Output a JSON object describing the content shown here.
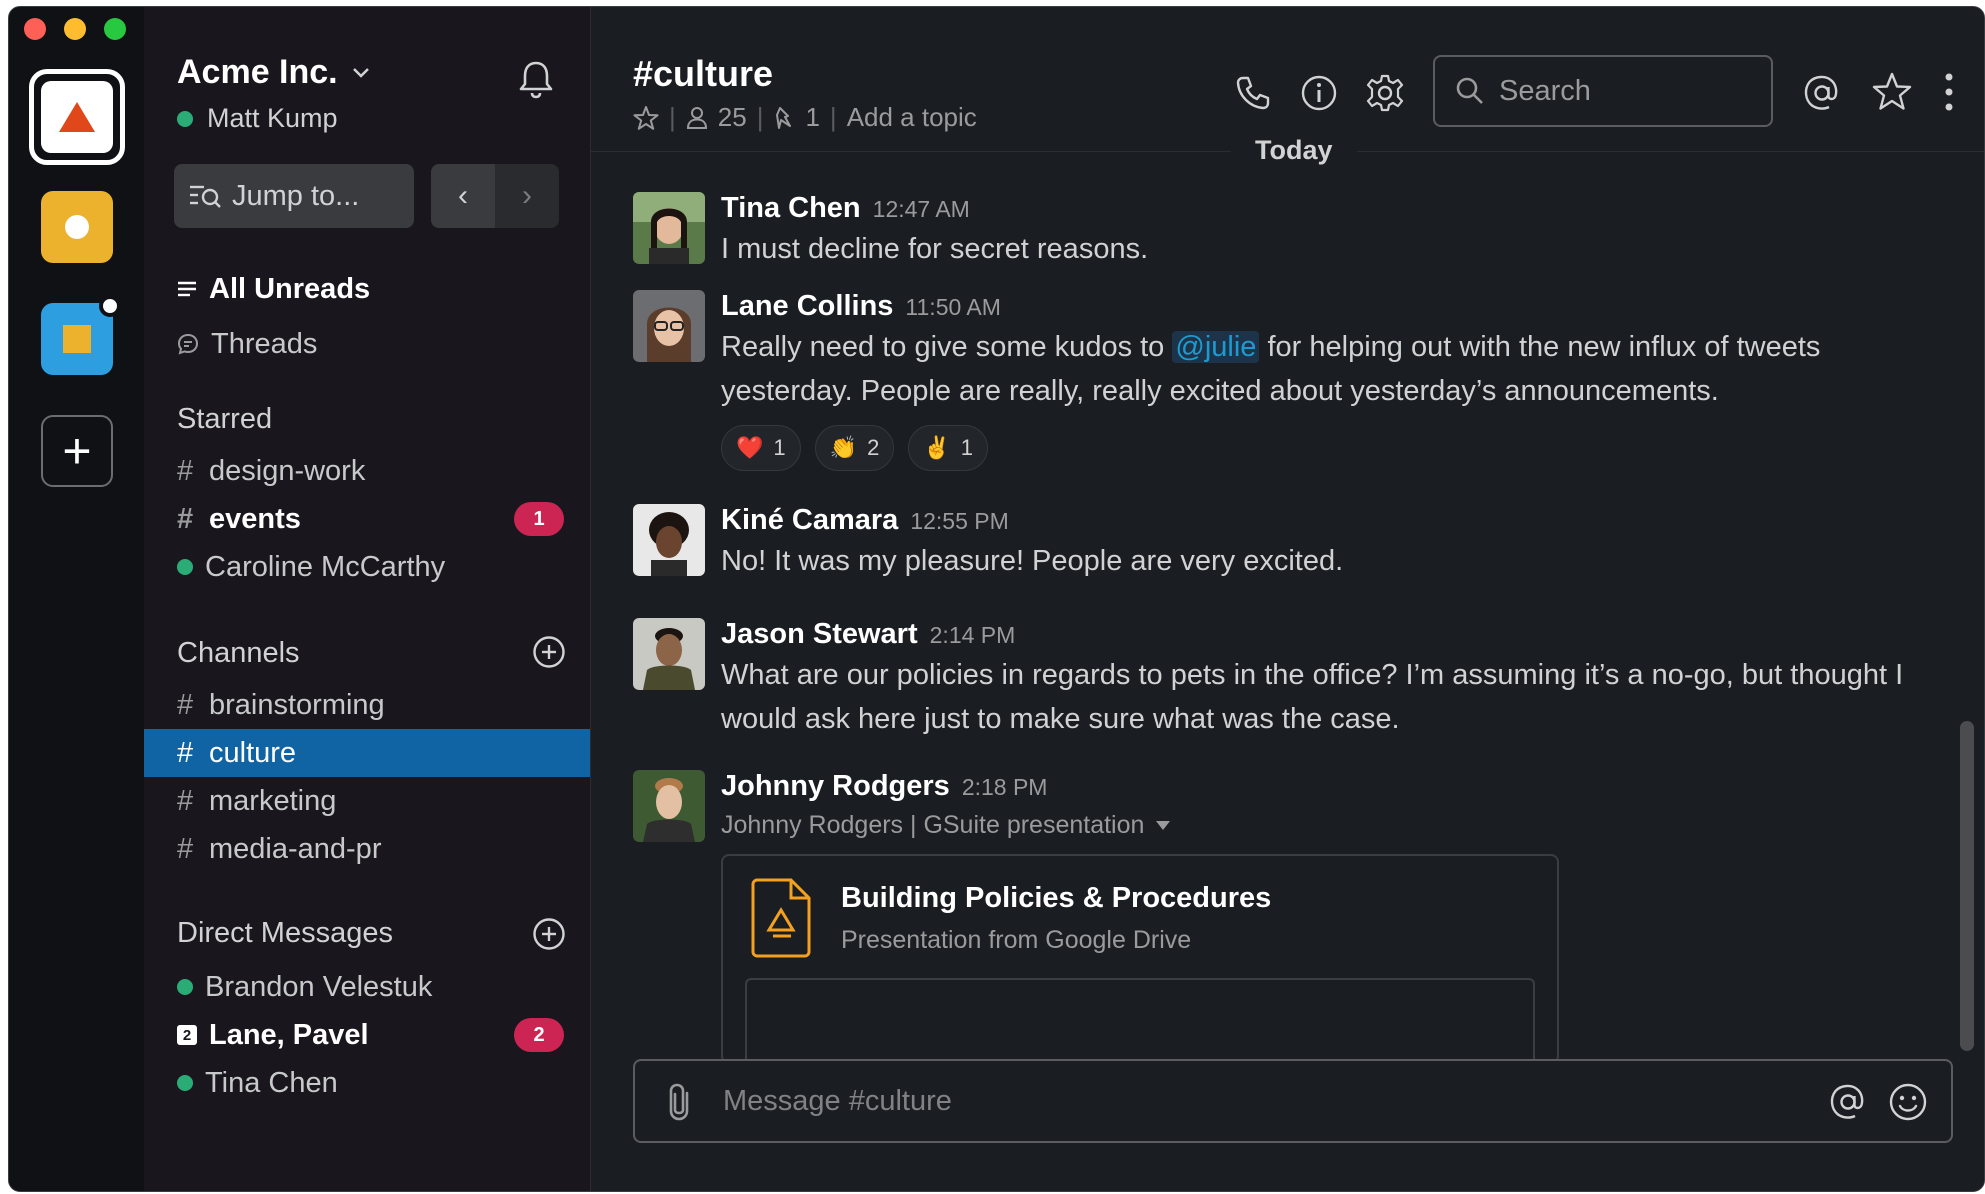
{
  "workspace": {
    "name": "Acme Inc.",
    "user": "Matt Kump",
    "colors": {
      "accent": "#1164a3",
      "badge": "#cd2553",
      "presence": "#2bac76",
      "mention": "#1d9bd1"
    }
  },
  "sidebar": {
    "jump_label": "Jump to...",
    "all_unreads": "All Unreads",
    "threads": "Threads",
    "starred_label": "Starred",
    "starred": [
      {
        "name": "design-work",
        "type": "channel",
        "bold": false
      },
      {
        "name": "events",
        "type": "channel",
        "bold": true,
        "badge": "1"
      },
      {
        "name": "Caroline McCarthy",
        "type": "dm"
      }
    ],
    "channels_label": "Channels",
    "channels": [
      {
        "name": "brainstorming"
      },
      {
        "name": "culture",
        "active": true
      },
      {
        "name": "marketing"
      },
      {
        "name": "media-and-pr"
      }
    ],
    "dms_label": "Direct Messages",
    "dms": [
      {
        "name": "Brandon Velestuk"
      },
      {
        "name": "Lane, Pavel",
        "group_count": "2",
        "bold": true,
        "badge": "2"
      },
      {
        "name": "Tina Chen"
      }
    ]
  },
  "channel": {
    "title": "#culture",
    "members": "25",
    "pins": "1",
    "topic_placeholder": "Add a topic",
    "search_placeholder": "Search",
    "day_divider": "Today"
  },
  "messages": [
    {
      "author": "Tina Chen",
      "time": "12:47 AM",
      "text": "I must decline for secret reasons."
    },
    {
      "author": "Lane Collins",
      "time": "11:50 AM",
      "text_before": "Really need to give some kudos to ",
      "mention": "@julie",
      "text_after": " for helping out with the new influx of tweets yesterday. People are really, really excited about yesterday’s announcements.",
      "reactions": [
        {
          "emoji": "❤️",
          "count": "1"
        },
        {
          "emoji": "👏",
          "count": "2"
        },
        {
          "emoji": "✌️",
          "count": "1"
        }
      ]
    },
    {
      "author": "Kiné Camara",
      "time": "12:55 PM",
      "text": "No! It was my pleasure! People are very excited."
    },
    {
      "author": "Jason Stewart",
      "time": "2:14 PM",
      "text": "What are our policies in regards to pets in the office? I’m assuming it’s a no-go, but thought I would ask here just to make sure what was the case."
    },
    {
      "author": "Johnny Rodgers",
      "time": "2:18 PM",
      "subline": "Johnny Rodgers | GSuite presentation",
      "attachment": {
        "title": "Building Policies & Procedures",
        "subtitle": "Presentation from Google Drive"
      }
    }
  ],
  "composer": {
    "placeholder": "Message #culture"
  }
}
